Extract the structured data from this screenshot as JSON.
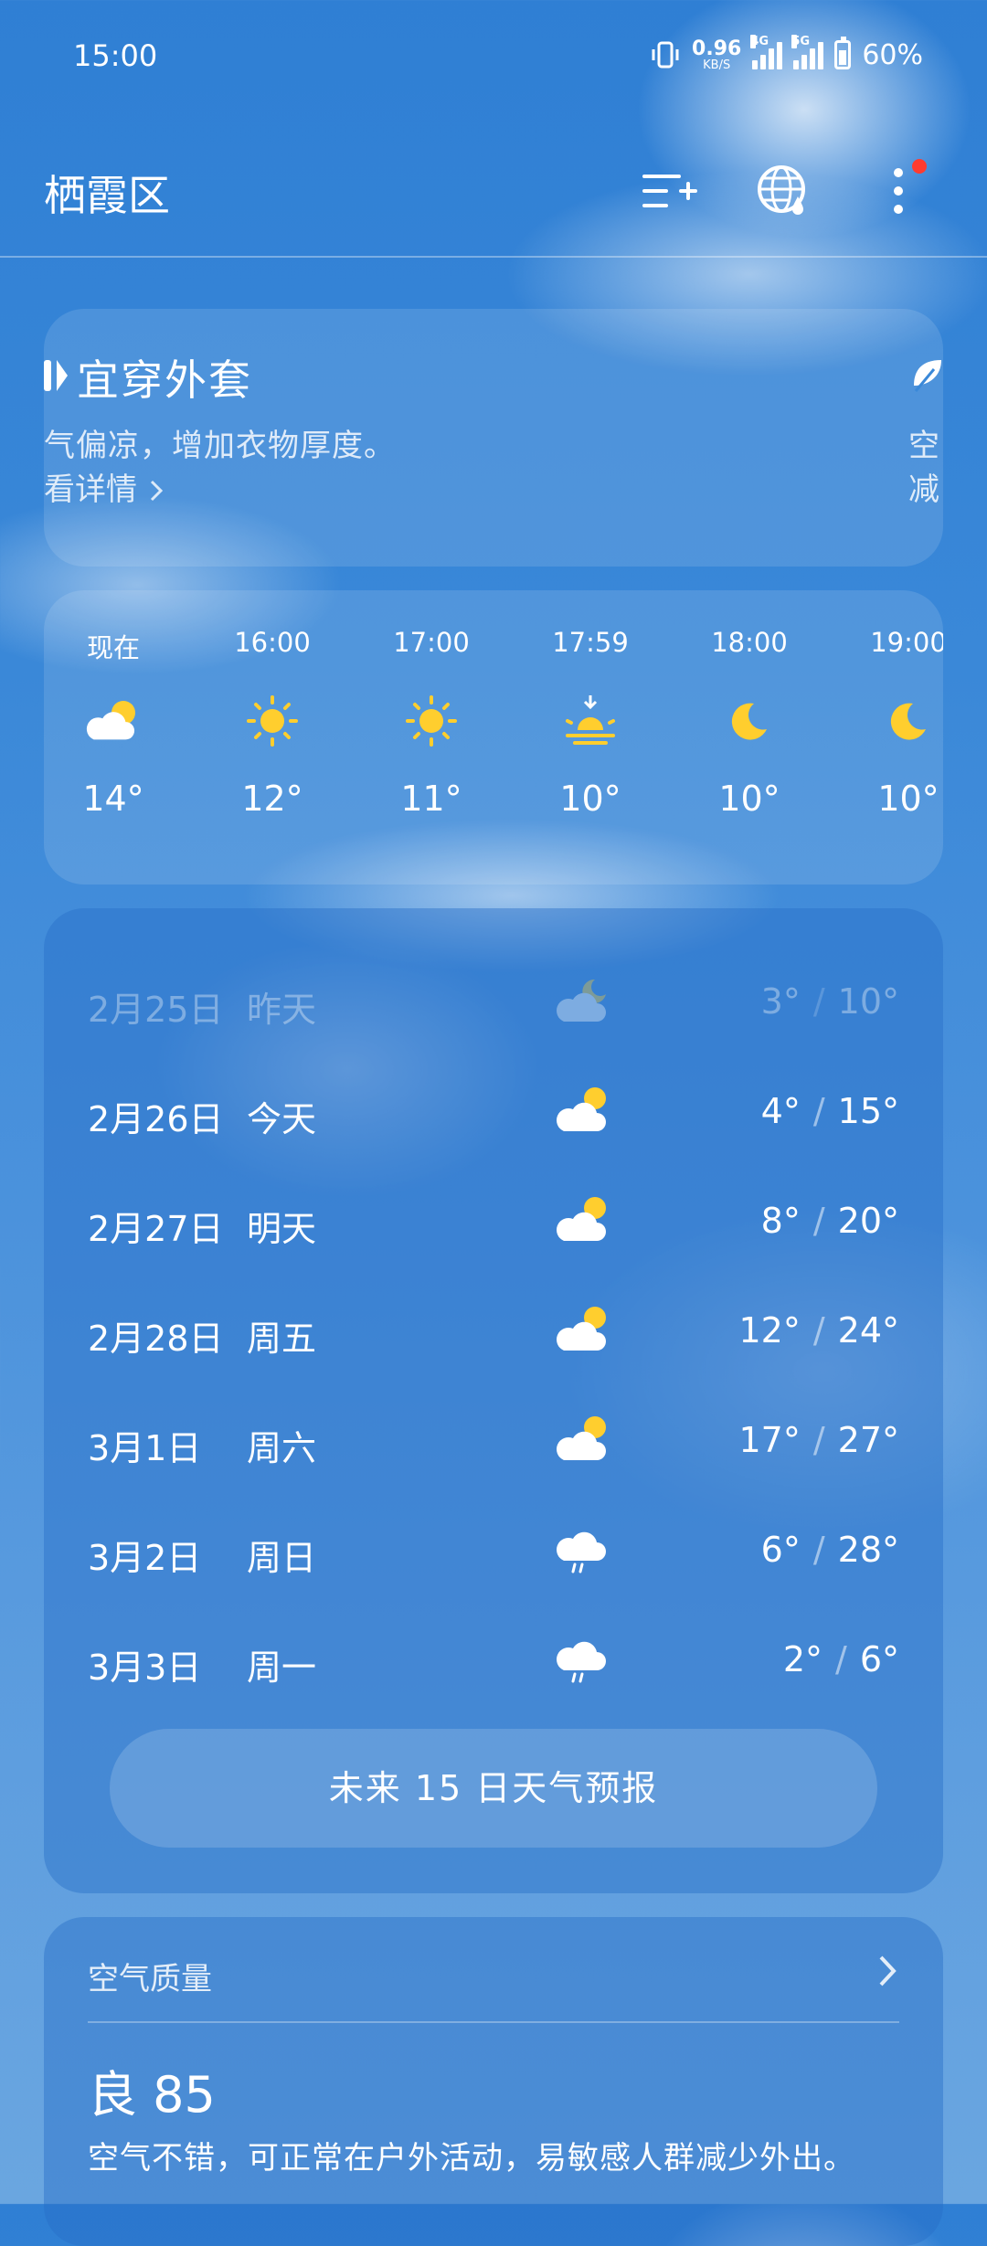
{
  "status_bar": {
    "time": "15:00",
    "net_speed_value": "0.96",
    "net_speed_unit": "KB/S",
    "signal1_label": "4G",
    "signal2_label": "5G",
    "battery": "60%"
  },
  "header": {
    "city": "栖霞区",
    "icons": [
      "manage-cities-icon",
      "global-weather-icon",
      "more-options-icon"
    ]
  },
  "advice": {
    "title": "宜穿外套",
    "desc": "气偏凉，增加衣物厚度。",
    "more": "看详情",
    "right_line1": "空",
    "right_line2": "减"
  },
  "hourly": [
    {
      "time": "现在",
      "icon": "partly-cloudy-day",
      "temp": "14°"
    },
    {
      "time": "16:00",
      "icon": "sunny",
      "temp": "12°"
    },
    {
      "time": "17:00",
      "icon": "sunny",
      "temp": "11°"
    },
    {
      "time": "17:59",
      "icon": "sunset",
      "temp": "10°"
    },
    {
      "time": "18:00",
      "icon": "moon",
      "temp": "10°"
    },
    {
      "time": "19:00",
      "icon": "moon",
      "temp": "10°"
    }
  ],
  "daily": [
    {
      "date": "2月25日",
      "day": "昨天",
      "icon": "cloudy-night",
      "low": "3°",
      "high": "10°",
      "past": true
    },
    {
      "date": "2月26日",
      "day": "今天",
      "icon": "partly-cloudy-day",
      "low": "4°",
      "high": "15°"
    },
    {
      "date": "2月27日",
      "day": "明天",
      "icon": "partly-cloudy-day",
      "low": "8°",
      "high": "20°"
    },
    {
      "date": "2月28日",
      "day": "周五",
      "icon": "partly-cloudy-day",
      "low": "12°",
      "high": "24°"
    },
    {
      "date": "3月1日",
      "day": "周六",
      "icon": "partly-cloudy-day",
      "low": "17°",
      "high": "27°"
    },
    {
      "date": "3月2日",
      "day": "周日",
      "icon": "rain",
      "low": "6°",
      "high": "28°"
    },
    {
      "date": "3月3日",
      "day": "周一",
      "icon": "rain",
      "low": "2°",
      "high": "6°"
    }
  ],
  "temp_separator": "/",
  "forecast_button": "未来 15 日天气预报",
  "aqi": {
    "title": "空气质量",
    "value": "良 85",
    "desc": "空气不错，可正常在户外活动，易敏感人群减少外出。"
  },
  "colors": {
    "sun": "#ffce2e",
    "notification_dot": "#ff3b30"
  }
}
